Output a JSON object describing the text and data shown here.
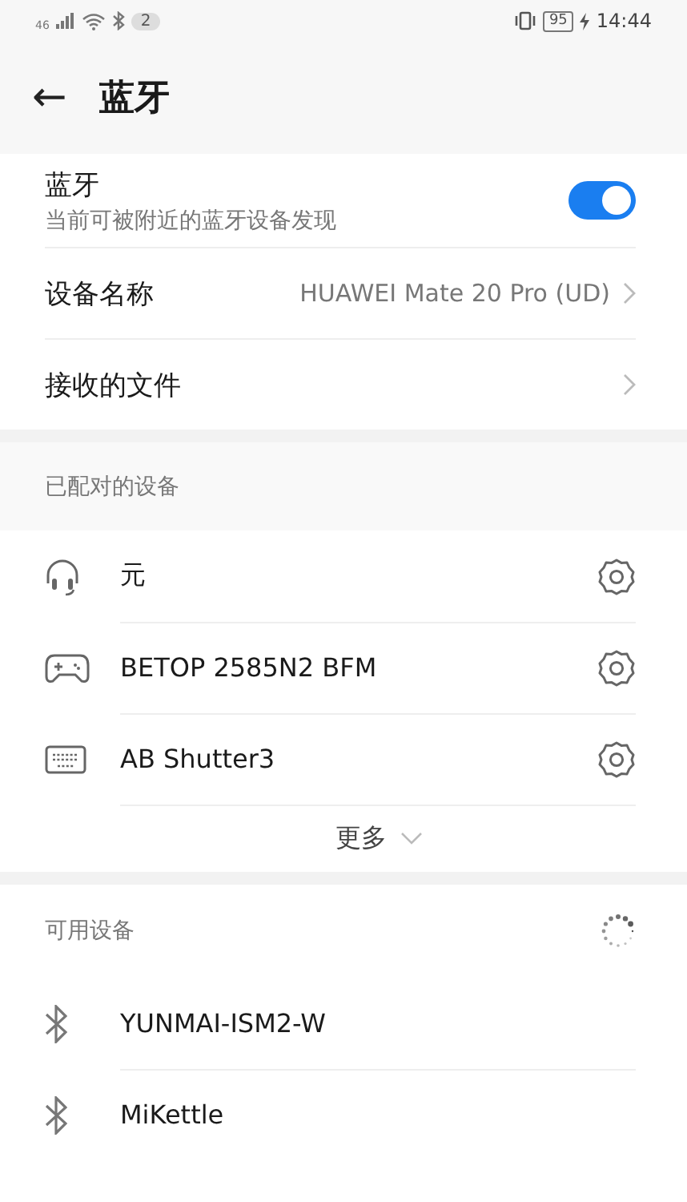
{
  "status_bar": {
    "network": "46",
    "notifications": "2",
    "battery": "95",
    "time": "14:44"
  },
  "header": {
    "back": "←",
    "title": "蓝牙"
  },
  "bluetooth": {
    "label": "蓝牙",
    "description": "当前可被附近的蓝牙设备发现",
    "on": true
  },
  "settings": [
    {
      "label": "设备名称",
      "value": "HUAWEI Mate 20 Pro (UD)"
    },
    {
      "label": "接收的文件"
    }
  ],
  "paired": {
    "title": "已配对的设备",
    "devices": [
      {
        "kind": "headphones",
        "name": "元"
      },
      {
        "kind": "gamepad",
        "name": "BETOP 2585N2 BFM"
      },
      {
        "kind": "keyboard",
        "name": "AB Shutter3"
      }
    ],
    "more": "更多"
  },
  "available": {
    "title": "可用设备",
    "devices": [
      {
        "kind": "bluetooth",
        "name": "YUNMAI-ISM2-W"
      },
      {
        "kind": "bluetooth",
        "name": "MiKettle"
      }
    ]
  }
}
